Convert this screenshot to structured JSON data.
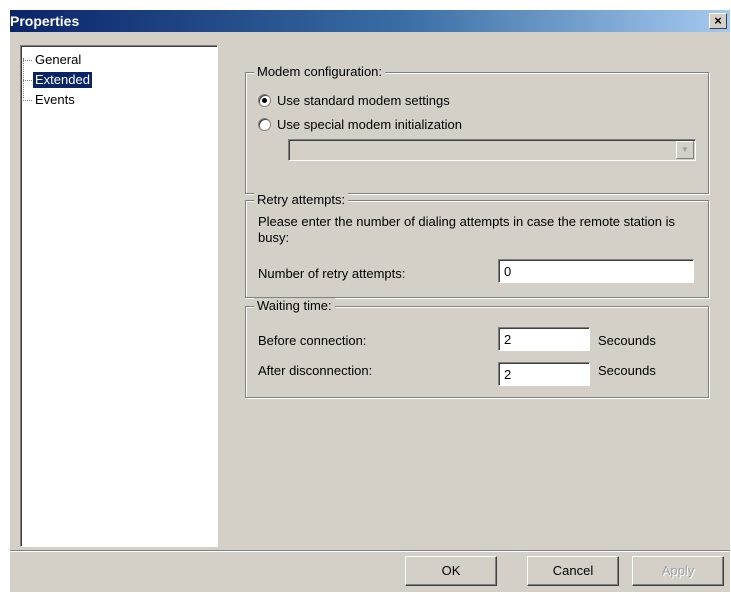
{
  "window": {
    "title": "Properties",
    "close_glyph": "×"
  },
  "tree": {
    "items": [
      {
        "label": "General",
        "selected": false
      },
      {
        "label": "Extended",
        "selected": true
      },
      {
        "label": "Events",
        "selected": false
      }
    ]
  },
  "modem": {
    "legend": "Modem configuration:",
    "option_standard": "Use standard modem settings",
    "option_special": "Use special modem initialization",
    "selected_option": "standard",
    "init_string": ""
  },
  "retry": {
    "legend": "Retry attempts:",
    "description": "Please enter the number of dialing attempts in case the remote station is busy:",
    "count_label": "Number of retry attempts:",
    "count_value": "0"
  },
  "waiting": {
    "legend": "Waiting time:",
    "before_label": "Before connection:",
    "before_value": "2",
    "before_unit": "Secounds",
    "after_label": "After disconnection:",
    "after_value": "2",
    "after_unit": "Secounds"
  },
  "buttons": {
    "ok": "OK",
    "cancel": "Cancel",
    "apply": "Apply",
    "apply_enabled": false
  },
  "colors": {
    "title_bar": "#0a246a",
    "selection": "#0a246a",
    "dialog_bg": "#d4d0c8"
  }
}
